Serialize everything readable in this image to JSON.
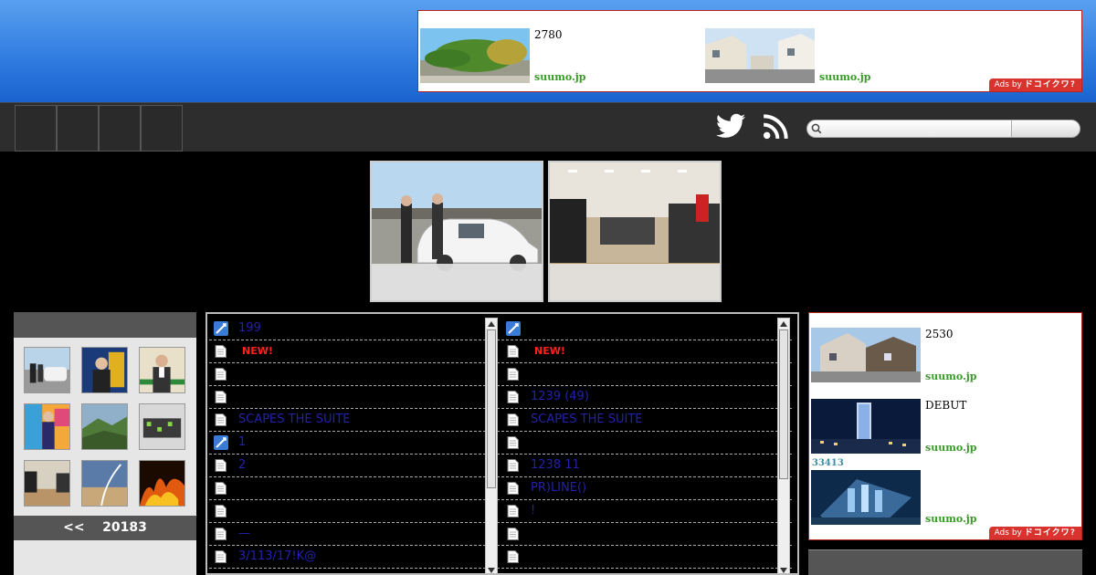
{
  "ads_top": {
    "units": [
      {
        "text": "2780",
        "domain": "suumo.jp"
      },
      {
        "text": "",
        "domain": "suumo.jp"
      }
    ],
    "badge_prefix": "Ads by",
    "badge_brand": "ドコイクワ?"
  },
  "nav": {
    "icons": [
      "twitter-icon",
      "rss-icon"
    ],
    "search": {
      "placeholder": "",
      "button_label": ""
    }
  },
  "left_panel": {
    "pager_prev": "<<",
    "pager_label": "20183"
  },
  "lists": {
    "left": [
      {
        "icon": "feed",
        "text": "199"
      },
      {
        "icon": "doc",
        "text": "",
        "badge": "NEW!"
      },
      {
        "icon": "doc",
        "text": ""
      },
      {
        "icon": "doc",
        "text": ""
      },
      {
        "icon": "doc",
        "text": "SCAPES THE SUITE"
      },
      {
        "icon": "feed",
        "text": "1"
      },
      {
        "icon": "doc",
        "text": "2"
      },
      {
        "icon": "doc",
        "text": ""
      },
      {
        "icon": "doc",
        "text": ""
      },
      {
        "icon": "doc",
        "text": "—"
      },
      {
        "icon": "doc",
        "text": "3/113/17!K@"
      }
    ],
    "right": [
      {
        "icon": "feed",
        "text": ""
      },
      {
        "icon": "doc",
        "text": "",
        "badge": "NEW!"
      },
      {
        "icon": "doc",
        "text": ""
      },
      {
        "icon": "doc",
        "text": "1239 (49)"
      },
      {
        "icon": "doc",
        "text": "SCAPES THE SUITE"
      },
      {
        "icon": "doc",
        "text": ""
      },
      {
        "icon": "doc",
        "text": "1238 11"
      },
      {
        "icon": "doc",
        "text": "PR)LINE()"
      },
      {
        "icon": "doc",
        "text": "!"
      },
      {
        "icon": "doc",
        "text": ""
      },
      {
        "icon": "doc",
        "text": ""
      }
    ]
  },
  "ads_right": {
    "units": [
      {
        "text": "2530",
        "domain": "suumo.jp"
      },
      {
        "text": "DEBUT",
        "domain": "suumo.jp"
      },
      {
        "text": "",
        "domain": "suumo.jp"
      }
    ],
    "extra": "33413",
    "badge_prefix": "Ads by",
    "badge_brand": "ドコイクワ?"
  },
  "colors": {
    "header_blue": "#2e7be0",
    "link_blue": "#2222aa",
    "new_red": "#ff2020",
    "ad_green": "#3a9a2a",
    "ad_badge_red": "#d9332f"
  }
}
